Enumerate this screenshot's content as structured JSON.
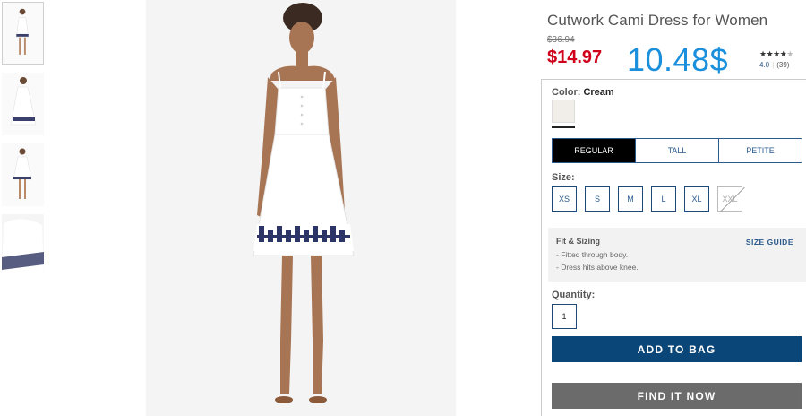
{
  "product": {
    "title": "Cutwork Cami Dress for Women",
    "original_price": "$36.94",
    "sale_price": "$14.97",
    "alt_price": "10.48$",
    "rating": {
      "stars_filled": "★★★★",
      "stars_empty": "★",
      "score": "4.0",
      "count": "(39)"
    }
  },
  "thumbnails": [
    {
      "name": "thumbnail-front-full"
    },
    {
      "name": "thumbnail-side"
    },
    {
      "name": "thumbnail-back"
    },
    {
      "name": "thumbnail-hem-detail"
    }
  ],
  "color": {
    "label": "Color:",
    "value": "Cream",
    "swatch_hex": "#f1eeea"
  },
  "fit_tabs": [
    {
      "label": "REGULAR",
      "active": true
    },
    {
      "label": "TALL",
      "active": false
    },
    {
      "label": "PETITE",
      "active": false
    }
  ],
  "size": {
    "label": "Size:",
    "options": [
      {
        "label": "XS",
        "available": true
      },
      {
        "label": "S",
        "available": true
      },
      {
        "label": "M",
        "available": true
      },
      {
        "label": "L",
        "available": true
      },
      {
        "label": "XL",
        "available": true
      },
      {
        "label": "XXL",
        "available": false
      }
    ]
  },
  "fit_sizing": {
    "title": "Fit & Sizing",
    "guide_link": "SIZE GUIDE",
    "notes": [
      "- Fitted through body.",
      "- Dress hits above knee."
    ]
  },
  "quantity": {
    "label": "Quantity:",
    "value": "1"
  },
  "actions": {
    "add_to_bag": "ADD TO BAG",
    "find_it_now": "FIND IT NOW"
  },
  "colors": {
    "sale_red": "#d0021b",
    "alt_price_blue": "#1a8fdc",
    "primary_navy": "#0a4677",
    "secondary_gray": "#6b6b6b"
  }
}
